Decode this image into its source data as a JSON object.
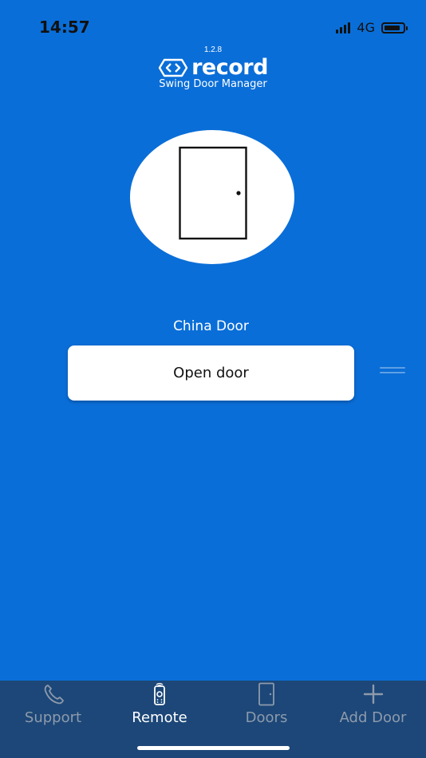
{
  "status_bar": {
    "time": "14:57",
    "network": "4G"
  },
  "brand": {
    "version": "1.2.8",
    "logo_text": "record",
    "subtitle": "Swing Door Manager"
  },
  "door": {
    "name": "China Door",
    "action_label": "Open door"
  },
  "tabs": [
    {
      "label": "Support",
      "icon": "phone-icon",
      "active": false
    },
    {
      "label": "Remote",
      "icon": "remote-control-icon",
      "active": true
    },
    {
      "label": "Doors",
      "icon": "door-icon",
      "active": false
    },
    {
      "label": "Add Door",
      "icon": "plus-icon",
      "active": false
    }
  ],
  "colors": {
    "background": "#0A6ED8",
    "tab_bar": "#1C4778",
    "tab_inactive": "#8E9AAB",
    "tab_active": "#FFFFFF"
  }
}
